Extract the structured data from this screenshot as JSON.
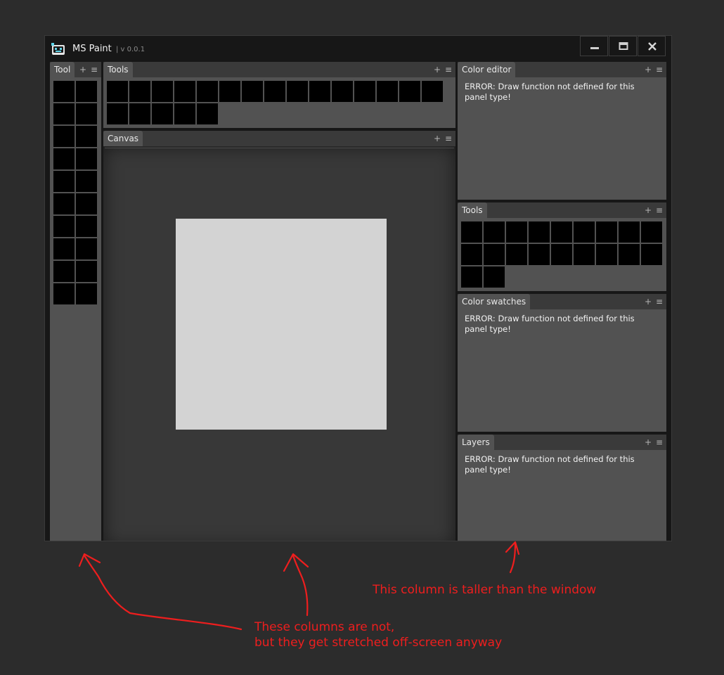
{
  "window": {
    "title": "MS Paint",
    "version": "| v 0.0.1",
    "controls": [
      "minimize-icon",
      "maximize-icon",
      "close-icon"
    ]
  },
  "panels": {
    "left_tools": {
      "title": "Tool",
      "plus": "+",
      "menu": "≡"
    },
    "top_tools": {
      "title": "Tools",
      "plus": "+",
      "menu": "≡"
    },
    "canvas": {
      "title": "Canvas",
      "plus": "+",
      "menu": "≡"
    },
    "color_editor": {
      "title": "Color editor",
      "plus": "+",
      "menu": "≡",
      "message": "ERROR: Draw function not defined for this panel type!"
    },
    "right_tools": {
      "title": "Tools",
      "plus": "+",
      "menu": "≡"
    },
    "color_swatches": {
      "title": "Color swatches",
      "plus": "+",
      "menu": "≡",
      "message": "ERROR: Draw function not defined for this panel type!"
    },
    "layers": {
      "title": "Layers",
      "plus": "+",
      "menu": "≡",
      "message": "ERROR: Draw function not defined for this panel type!"
    }
  },
  "annotations": {
    "right_column": "This column is taller than the window",
    "left_columns_line1": "These columns are not,",
    "left_columns_line2": "but they get stretched off-screen anyway"
  },
  "colors": {
    "background": "#2c2c2c",
    "window": "#171717",
    "panel": "#525252",
    "panel_header": "#3a3a3a",
    "tool_cell": "#000000",
    "canvas_surface": "#d3d3d3",
    "annotation": "#ee1e1e",
    "icon_accent": "#5fd4e8"
  }
}
